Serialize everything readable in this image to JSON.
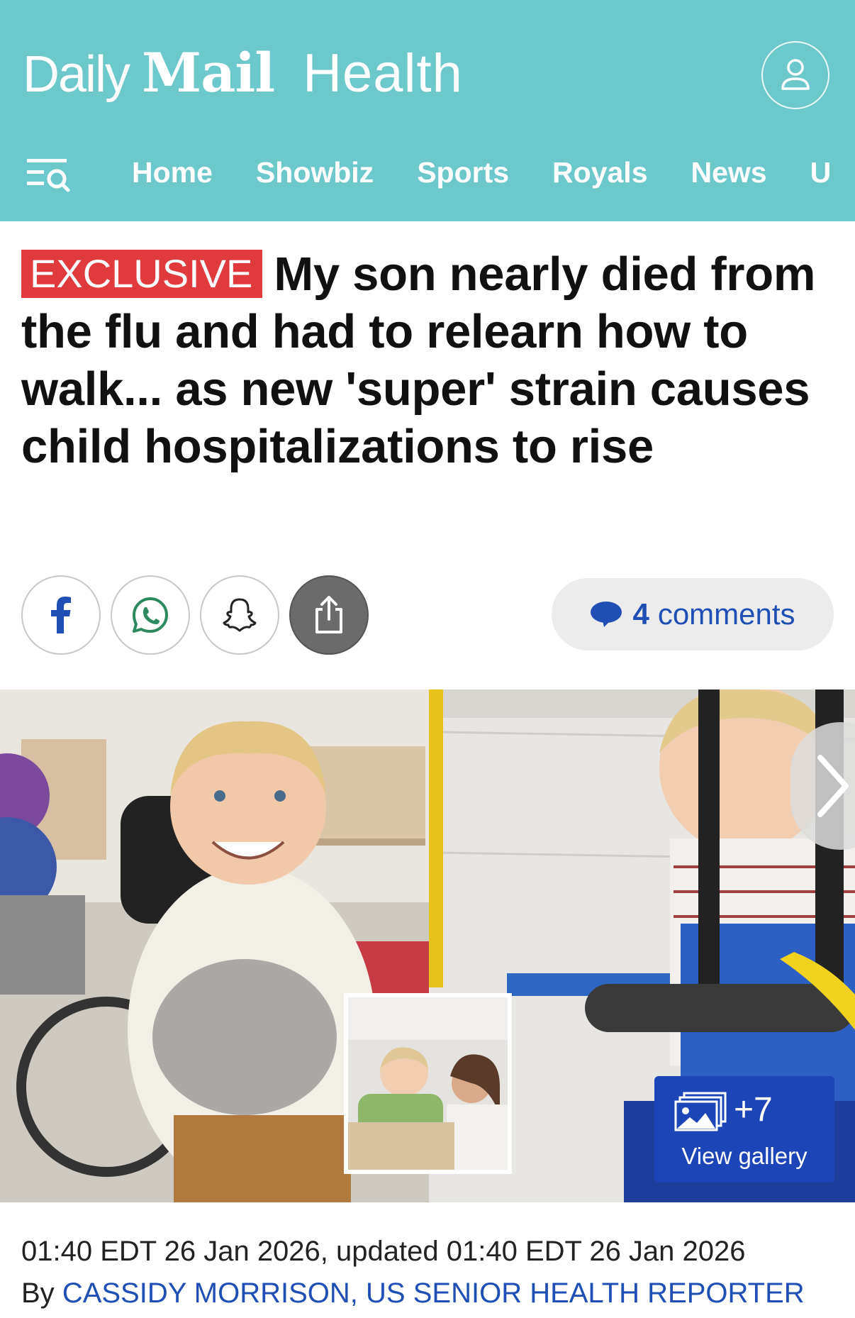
{
  "header": {
    "brand_daily": "Daily",
    "brand_mail": "Mail",
    "section": "Health",
    "background_color": "#6cc8ca"
  },
  "nav": {
    "items": [
      "Home",
      "Showbiz",
      "Sports",
      "Royals",
      "News",
      "U"
    ]
  },
  "article": {
    "badge": "EXCLUSIVE",
    "headline": "My son nearly died from the flu and had to relearn how to walk... as new 'super' strain causes child hospitalizations to rise",
    "comments_count": "4",
    "comments_label": "comments",
    "gallery_count": "+7",
    "gallery_label": "View gallery",
    "dateline": "01:40 EDT 26 Jan 2026, updated 01:40 EDT 26 Jan 2026",
    "by_prefix": "By",
    "author": "CASSIDY MORRISON, US SENIOR HEALTH REPORTER"
  },
  "share_icons": [
    "facebook-icon",
    "whatsapp-icon",
    "snapchat-icon",
    "share-icon"
  ],
  "colors": {
    "accent_red": "#e03a3c",
    "link_blue": "#1f4fb5",
    "gallery_blue": "#1c46b8"
  }
}
